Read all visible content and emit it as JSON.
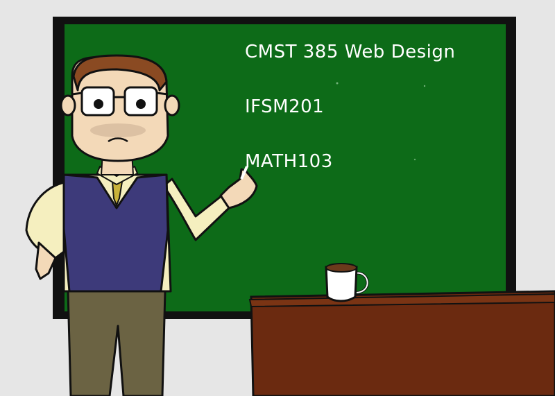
{
  "chalkboard": {
    "lines": [
      "CMST 385 Web Design",
      "IFSM201",
      "MATH103"
    ]
  },
  "colors": {
    "wall": "#e6e6e6",
    "board_frame": "#111111",
    "board": "#0d6b18",
    "desk": "#6b2a10",
    "vest": "#3d3a7a",
    "shirt": "#f5efbf",
    "pants": "#6b6343",
    "skin": "#f3d9b8",
    "hair": "#8a4a22",
    "mug": "#ffffff",
    "coffee": "#6b3a1c"
  }
}
